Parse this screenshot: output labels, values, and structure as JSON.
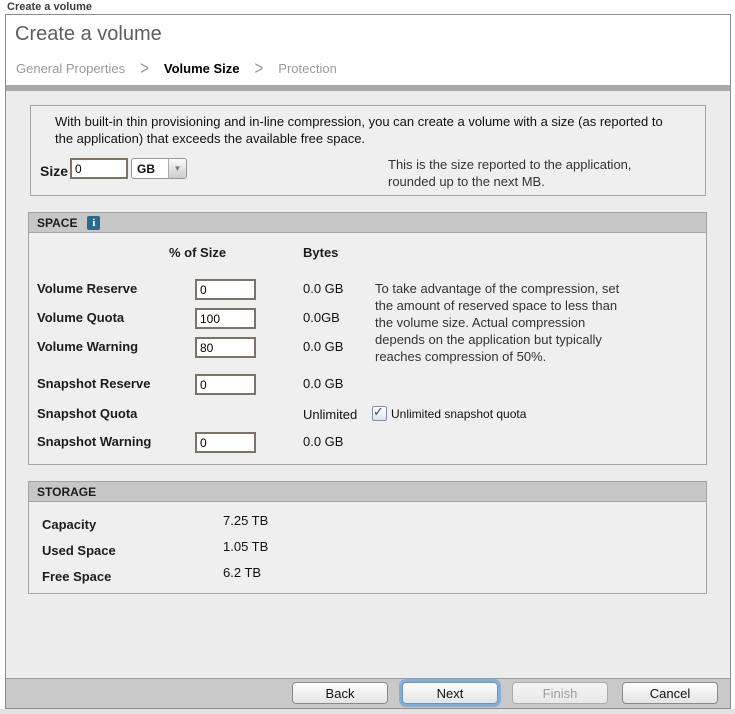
{
  "window_title": "Create a volume",
  "header": {
    "title": "Create a volume",
    "steps": [
      {
        "label": "General Properties",
        "active": false
      },
      {
        "label": "Volume Size",
        "active": true
      },
      {
        "label": "Protection",
        "active": false
      }
    ]
  },
  "icons": {
    "breadcrumb_chevron": ">",
    "info": "i",
    "dropdown_arrow": "▼",
    "checkmark": "✓"
  },
  "size_section": {
    "description": "With built-in thin provisioning and in-line compression, you can create a volume with a size (as reported to the application) that exceeds the available free space.",
    "size_label": "Size",
    "size_value": "0",
    "unit_value": "GB",
    "note": "This is the size reported to the application, rounded up to the next MB."
  },
  "space_section": {
    "title": "SPACE",
    "columns": {
      "percent": "% of Size",
      "bytes": "Bytes"
    },
    "rows": [
      {
        "label": "Volume Reserve",
        "input": "0",
        "bytes": "0.0 GB"
      },
      {
        "label": "Volume Quota",
        "input": "100",
        "bytes": "0.0GB"
      },
      {
        "label": "Volume Warning",
        "input": "80",
        "bytes": "0.0 GB"
      },
      {
        "label": "Snapshot Reserve",
        "input": "0",
        "bytes": "0.0 GB"
      },
      {
        "label": "Snapshot Quota",
        "bytes": "Unlimited",
        "checkbox": {
          "checked": true,
          "label": "Unlimited snapshot quota"
        }
      },
      {
        "label": "Snapshot Warning",
        "input": "0",
        "bytes": "0.0 GB"
      }
    ],
    "note": "To take advantage of the compression, set the amount of reserved space to less than the volume size. Actual compression depends on the application but typically reaches compression of 50%."
  },
  "storage_section": {
    "title": "STORAGE",
    "rows": [
      {
        "label": "Capacity",
        "value": "7.25 TB"
      },
      {
        "label": "Used Space",
        "value": "1.05 TB"
      },
      {
        "label": "Free Space",
        "value": "6.2 TB"
      }
    ]
  },
  "footer": {
    "buttons": [
      {
        "label": "Back",
        "state": "normal"
      },
      {
        "label": "Next",
        "state": "focused"
      },
      {
        "label": "Finish",
        "state": "disabled"
      },
      {
        "label": "Cancel",
        "state": "normal"
      }
    ]
  },
  "colors": {
    "focus_ring": "#84aed8",
    "info_icon": "#2a6a92",
    "section_bar": "#c7c7c7",
    "body_bg": "#ececec"
  }
}
